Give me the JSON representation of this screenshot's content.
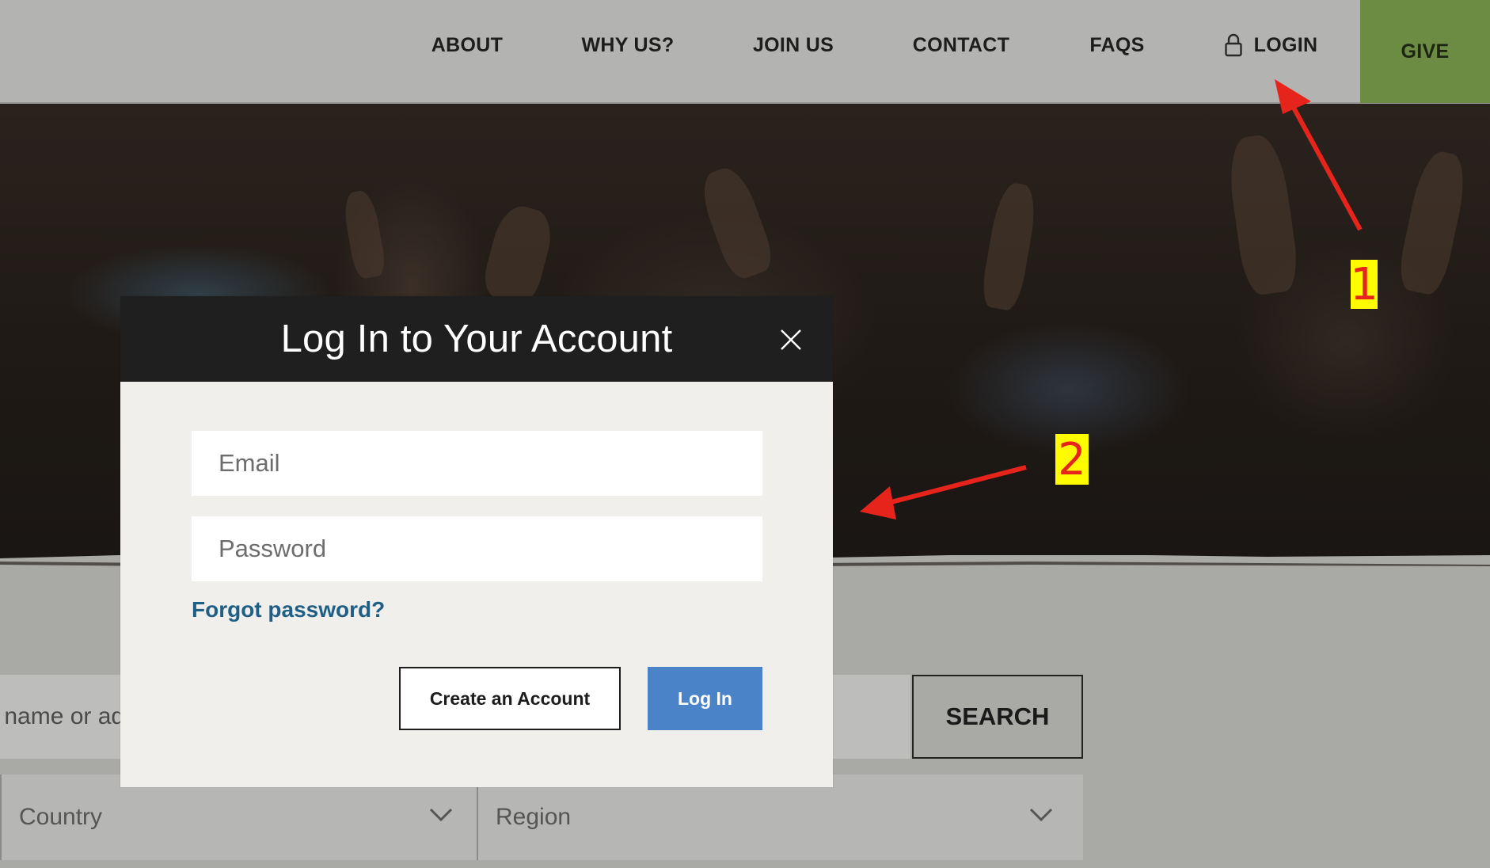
{
  "nav": {
    "about": "ABOUT",
    "why_us": "WHY US?",
    "join_us": "JOIN US",
    "contact": "CONTACT",
    "faqs": "FAQS",
    "login": "LOGIN",
    "give": "GIVE"
  },
  "search": {
    "input_visible_text": "y name or ad",
    "button_label": "SEARCH"
  },
  "filters": {
    "country": "Country",
    "region": "Region"
  },
  "modal": {
    "title": "Log In to Your Account",
    "email_placeholder": "Email",
    "password_placeholder": "Password",
    "forgot_password": "Forgot password?",
    "create_account": "Create an Account",
    "log_in": "Log In"
  },
  "annotations": {
    "label_1": "1",
    "label_2": "2"
  },
  "colors": {
    "give_button": "#6b8c42",
    "login_button": "#4a83c7",
    "forgot_link": "#1f5f86",
    "modal_header": "#1f1f1f",
    "annotation_arrow": "#e6241b",
    "annotation_label_bg": "#fffb00"
  }
}
